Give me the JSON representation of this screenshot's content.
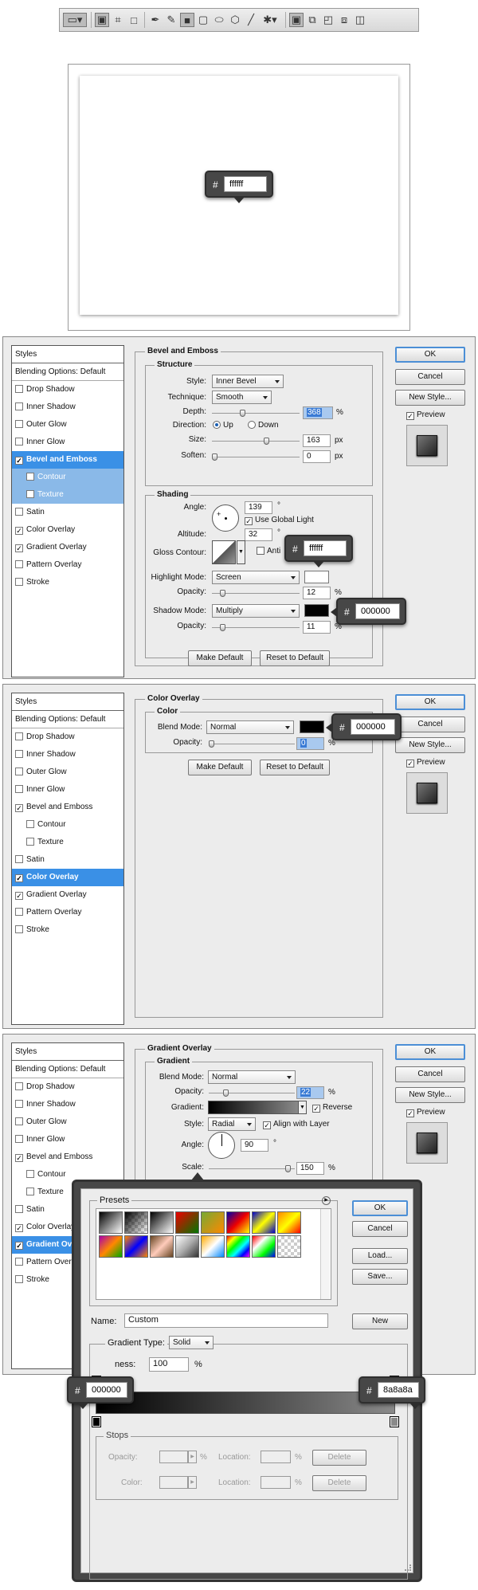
{
  "colors": {
    "white": "#ffffff",
    "black": "#000000",
    "grey": "#8a8a8a",
    "accent": "#3a90e6"
  },
  "toolbar": {
    "icons": [
      "rectangle-tool-icon",
      "shape-layers-icon",
      "paths-icon",
      "fill-pixels-icon",
      "pen-icon",
      "freeform-pen-icon",
      "rectangle-shape-icon",
      "rounded-rectangle-icon",
      "ellipse-icon",
      "polygon-icon",
      "line-icon",
      "custom-shape-icon",
      "new-layer-icon",
      "add-shape-icon",
      "subtract-shape-icon",
      "intersect-shape-icon",
      "exclude-shape-icon"
    ]
  },
  "canvas": {
    "tooltip_hash": "#",
    "tooltip_value": "ffffff"
  },
  "styles_list": {
    "title": "Styles",
    "blending": "Blending Options: Default",
    "items": [
      "Drop Shadow",
      "Inner Shadow",
      "Outer Glow",
      "Inner Glow",
      "Bevel and Emboss",
      "Contour",
      "Texture",
      "Satin",
      "Color Overlay",
      "Gradient Overlay",
      "Pattern Overlay",
      "Stroke"
    ]
  },
  "buttons": {
    "ok": "OK",
    "cancel": "Cancel",
    "new_style": "New Style...",
    "preview": "Preview",
    "make_default": "Make Default",
    "reset": "Reset to Default"
  },
  "bevel": {
    "title": "Bevel and Emboss",
    "structure": "Structure",
    "style_label": "Style:",
    "style": "Inner Bevel",
    "technique_label": "Technique:",
    "technique": "Smooth",
    "depth_label": "Depth:",
    "depth": "368",
    "pct": "%",
    "direction_label": "Direction:",
    "up": "Up",
    "down": "Down",
    "size_label": "Size:",
    "size": "163",
    "px": "px",
    "soften_label": "Soften:",
    "soften": "0",
    "shading": "Shading",
    "angle_label": "Angle:",
    "angle": "139",
    "deg": "°",
    "global_light": "Use Global Light",
    "altitude_label": "Altitude:",
    "altitude": "32",
    "gloss_label": "Gloss Contour:",
    "anti": "Anti",
    "highlight_label": "Highlight Mode:",
    "highlight": "Screen",
    "opacity_label": "Opacity:",
    "hl_opacity": "12",
    "shadow_label": "Shadow Mode:",
    "shadow": "Multiply",
    "sh_opacity": "11",
    "tip_hl": "ffffff",
    "tip_sh": "000000"
  },
  "overlay": {
    "title": "Color Overlay",
    "color": "Color",
    "blend_label": "Blend Mode:",
    "blend": "Normal",
    "opacity_label": "Opacity:",
    "opacity": "0",
    "pct": "%",
    "tip": "000000"
  },
  "gradient": {
    "title": "Gradient Overlay",
    "sub": "Gradient",
    "blend_label": "Blend Mode:",
    "blend": "Normal",
    "opacity_label": "Opacity:",
    "opacity": "22",
    "pct": "%",
    "grad_label": "Gradient:",
    "reverse": "Reverse",
    "style_label": "Style:",
    "style": "Radial",
    "align": "Align with Layer",
    "angle_label": "Angle:",
    "angle": "90",
    "deg": "°",
    "scale_label": "Scale:",
    "scale": "150"
  },
  "editor": {
    "presets": "Presets",
    "ok": "OK",
    "cancel": "Cancel",
    "load": "Load...",
    "save": "Save...",
    "name_label": "Name:",
    "name": "Custom",
    "new": "New",
    "type_label": "Gradient Type:",
    "type": "Solid",
    "smooth_label": "ness:",
    "smooth": "100",
    "pct": "%",
    "tip_left": "000000",
    "tip_right": "8a8a8a",
    "stops": "Stops",
    "opacity_label": "Opacity:",
    "color_label": "Color:",
    "location_label": "Location:",
    "delete": "Delete"
  }
}
